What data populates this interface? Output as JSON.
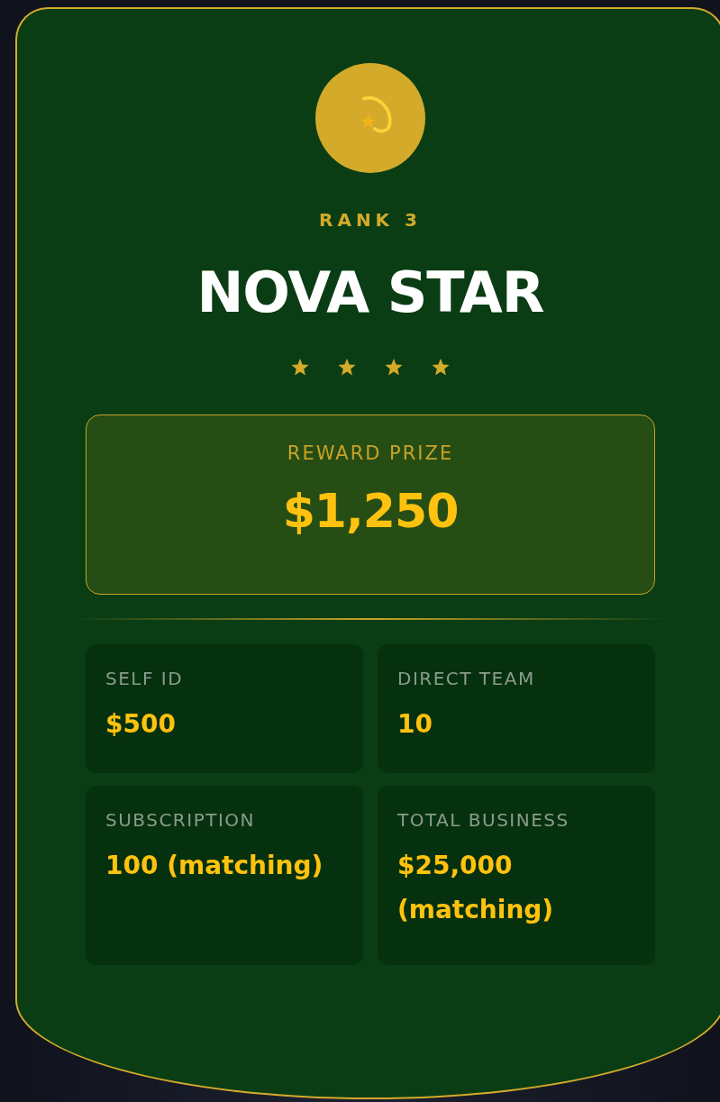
{
  "rank_label": "RANK 3",
  "title": "NOVA STAR",
  "stars": 4,
  "reward": {
    "label": "REWARD PRIZE",
    "value": "$1,250"
  },
  "requirements": [
    {
      "label": "SELF ID",
      "value": "$500"
    },
    {
      "label": "DIRECT TEAM",
      "value": "10"
    },
    {
      "label": "SUBSCRIPTION",
      "value": "100 (matching)"
    },
    {
      "label": "TOTAL BUSINESS",
      "value": "$25,000 (matching)"
    }
  ]
}
